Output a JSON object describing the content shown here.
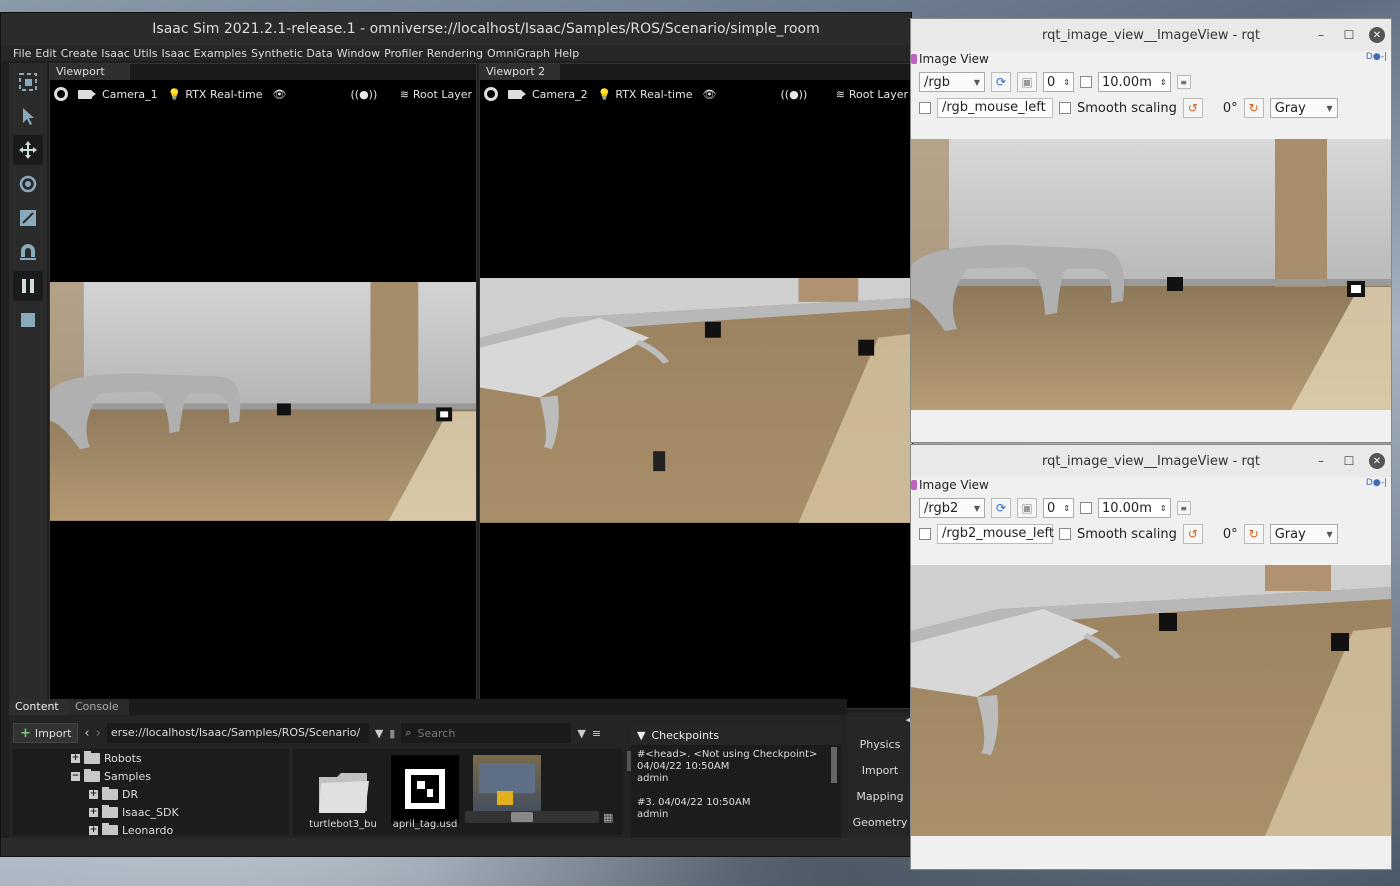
{
  "isaac": {
    "title": "Isaac Sim 2021.2.1-release.1 - omniverse://localhost/Isaac/Samples/ROS/Scenario/simple_room",
    "menu": [
      "File",
      "Edit",
      "Create",
      "Isaac Utils",
      "Isaac Examples",
      "Synthetic Data",
      "Window",
      "Profiler",
      "Rendering",
      "OmniGraph",
      "Help"
    ],
    "viewport1": {
      "tab": "Viewport",
      "camera": "Camera_1",
      "renderer": "RTX Real-time",
      "layer": "Root Layer"
    },
    "viewport2": {
      "tab": "Viewport 2",
      "camera": "Camera_2",
      "renderer": "RTX Real-time",
      "layer": "Root Layer"
    },
    "content": {
      "tabs": [
        "Content",
        "Console"
      ],
      "import_label": "Import",
      "path": "erse://localhost/Isaac/Samples/ROS/Scenario/",
      "search_placeholder": "Search",
      "tree": [
        "Robots",
        "Samples",
        "DR",
        "Isaac_SDK",
        "Leonardo"
      ],
      "thumbs": [
        "turtlebot3_bu",
        "april_tag.usd",
        ""
      ],
      "checkpoints": {
        "title": "Checkpoints",
        "entries": [
          {
            "line1": "#<head>.   <Not using Checkpoint>",
            "line2": "04/04/22 10:50AM",
            "line3": "admin"
          },
          {
            "line1": "#3.   04/04/22 10:50AM",
            "line2": "admin",
            "line3": ""
          }
        ]
      }
    },
    "side_tabs": [
      "Physics",
      "Import",
      "Mapping",
      "Geometry"
    ]
  },
  "rqt1": {
    "title": "rqt_image_view__ImageView - rqt",
    "panel_label": "Image View",
    "topic": "/rgb",
    "spin_value": "0",
    "distance": "10.00m",
    "mouse_topic": "/rgb_mouse_left",
    "smooth_label": "Smooth scaling",
    "rotation": "0°",
    "color_scheme": "Gray"
  },
  "rqt2": {
    "title": "rqt_image_view__ImageView - rqt",
    "panel_label": "Image View",
    "topic": "/rgb2",
    "spin_value": "0",
    "distance": "10.00m",
    "mouse_topic": "/rgb2_mouse_left",
    "smooth_label": "Smooth scaling",
    "rotation": "0°",
    "color_scheme": "Gray"
  }
}
